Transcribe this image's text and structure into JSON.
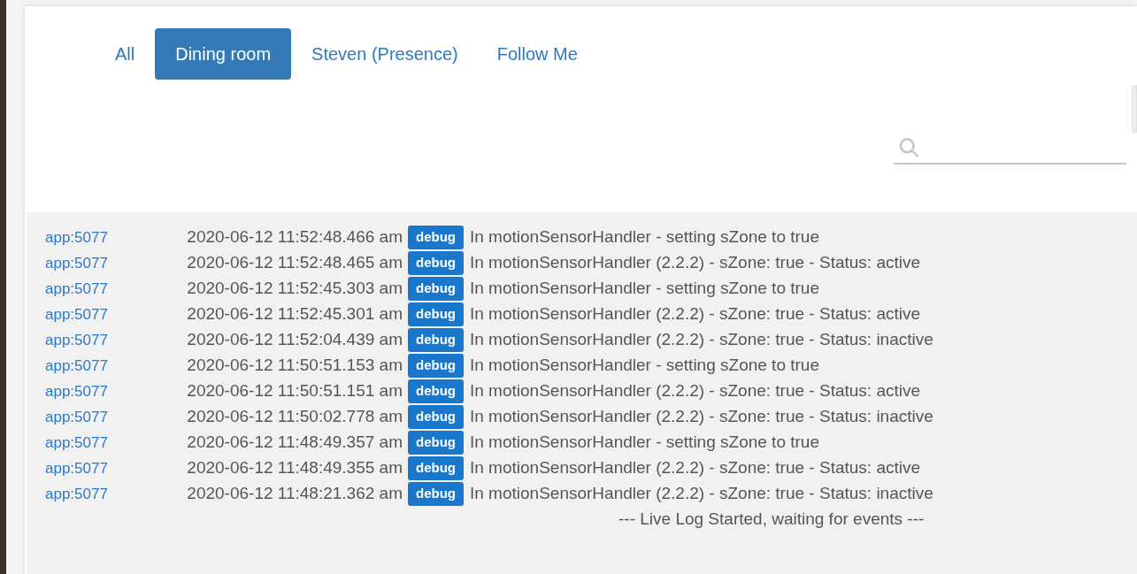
{
  "tabs": [
    {
      "label": "All",
      "selected": false
    },
    {
      "label": "Dining room",
      "selected": true
    },
    {
      "label": "Steven (Presence)",
      "selected": false
    },
    {
      "label": "Follow Me",
      "selected": false
    }
  ],
  "log": [
    {
      "source": "app:5077",
      "time": "2020-06-12 11:52:48.466 am",
      "badge": "debug",
      "message": "In motionSensorHandler - setting sZone to true"
    },
    {
      "source": "app:5077",
      "time": "2020-06-12 11:52:48.465 am",
      "badge": "debug",
      "message": "In motionSensorHandler (2.2.2) - sZone: true - Status: active"
    },
    {
      "source": "app:5077",
      "time": "2020-06-12 11:52:45.303 am",
      "badge": "debug",
      "message": "In motionSensorHandler - setting sZone to true"
    },
    {
      "source": "app:5077",
      "time": "2020-06-12 11:52:45.301 am",
      "badge": "debug",
      "message": "In motionSensorHandler (2.2.2) - sZone: true - Status: active"
    },
    {
      "source": "app:5077",
      "time": "2020-06-12 11:52:04.439 am",
      "badge": "debug",
      "message": "In motionSensorHandler (2.2.2) - sZone: true - Status: inactive"
    },
    {
      "source": "app:5077",
      "time": "2020-06-12 11:50:51.153 am",
      "badge": "debug",
      "message": "In motionSensorHandler - setting sZone to true"
    },
    {
      "source": "app:5077",
      "time": "2020-06-12 11:50:51.151 am",
      "badge": "debug",
      "message": "In motionSensorHandler (2.2.2) - sZone: true - Status: active"
    },
    {
      "source": "app:5077",
      "time": "2020-06-12 11:50:02.778 am",
      "badge": "debug",
      "message": "In motionSensorHandler (2.2.2) - sZone: true - Status: inactive"
    },
    {
      "source": "app:5077",
      "time": "2020-06-12 11:48:49.357 am",
      "badge": "debug",
      "message": "In motionSensorHandler - setting sZone to true"
    },
    {
      "source": "app:5077",
      "time": "2020-06-12 11:48:49.355 am",
      "badge": "debug",
      "message": "In motionSensorHandler (2.2.2) - sZone: true - Status: active"
    },
    {
      "source": "app:5077",
      "time": "2020-06-12 11:48:21.362 am",
      "badge": "debug",
      "message": "In motionSensorHandler (2.2.2) - sZone: true - Status: inactive"
    }
  ],
  "status": "--- Live Log Started, waiting for events ---"
}
